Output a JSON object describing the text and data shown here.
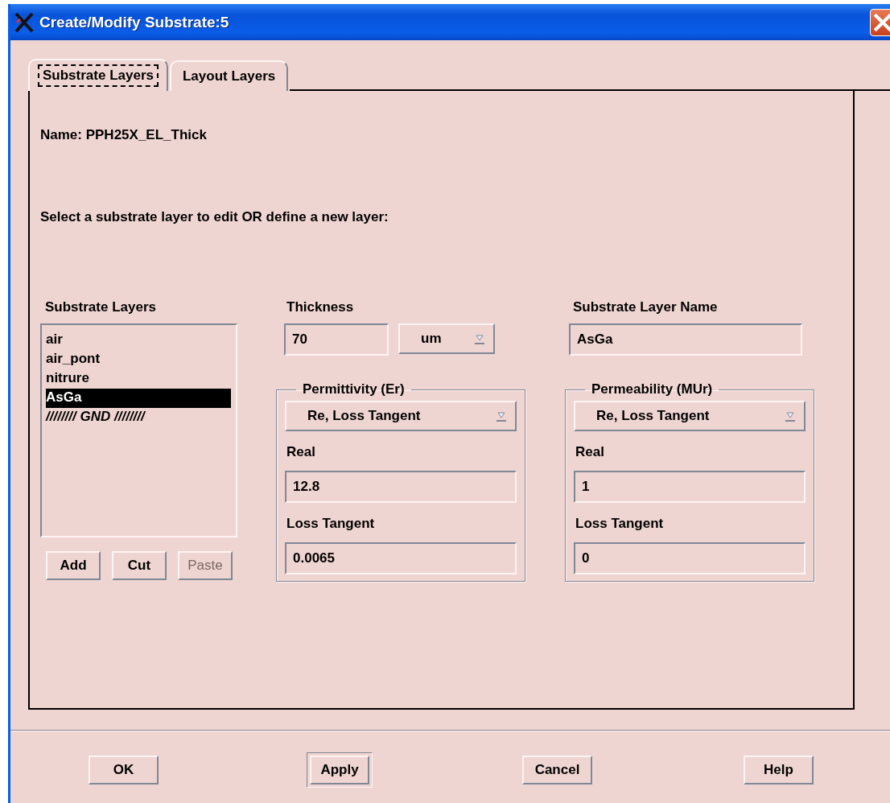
{
  "window": {
    "title": "Create/Modify Substrate:5"
  },
  "tabs": [
    {
      "label": "Substrate Layers",
      "selected": true
    },
    {
      "label": "Layout Layers",
      "selected": false
    }
  ],
  "name_line": "Name: PPH25X_EL_Thick",
  "instruction": "Select a substrate layer to edit OR define a new layer:",
  "layers": {
    "label": "Substrate Layers",
    "items": [
      {
        "label": "air",
        "selected": false,
        "kind": "layer"
      },
      {
        "label": "air_pont",
        "selected": false,
        "kind": "layer"
      },
      {
        "label": "nitrure",
        "selected": false,
        "kind": "layer"
      },
      {
        "label": "AsGa",
        "selected": true,
        "kind": "layer"
      },
      {
        "label": "//////// GND ////////",
        "selected": false,
        "kind": "ground"
      }
    ]
  },
  "layer_buttons": [
    {
      "label": "Add",
      "disabled": false
    },
    {
      "label": "Cut",
      "disabled": false
    },
    {
      "label": "Paste",
      "disabled": true
    }
  ],
  "thickness": {
    "label": "Thickness",
    "value": "70",
    "unit": "um"
  },
  "layer_name": {
    "label": "Substrate Layer Name",
    "value": "AsGa"
  },
  "permittivity": {
    "title": "Permittivity (Er)",
    "mode": "Re, Loss Tangent",
    "real_label": "Real",
    "real": "12.8",
    "loss_label": "Loss Tangent",
    "loss": "0.0065"
  },
  "permeability": {
    "title": "Permeability (MUr)",
    "mode": "Re, Loss Tangent",
    "real_label": "Real",
    "real": "1",
    "loss_label": "Loss Tangent",
    "loss": "0"
  },
  "buttons": [
    {
      "label": "OK",
      "default": false
    },
    {
      "label": "Apply",
      "default": true
    },
    {
      "label": "Cancel",
      "default": false
    },
    {
      "label": "Help",
      "default": false
    }
  ]
}
